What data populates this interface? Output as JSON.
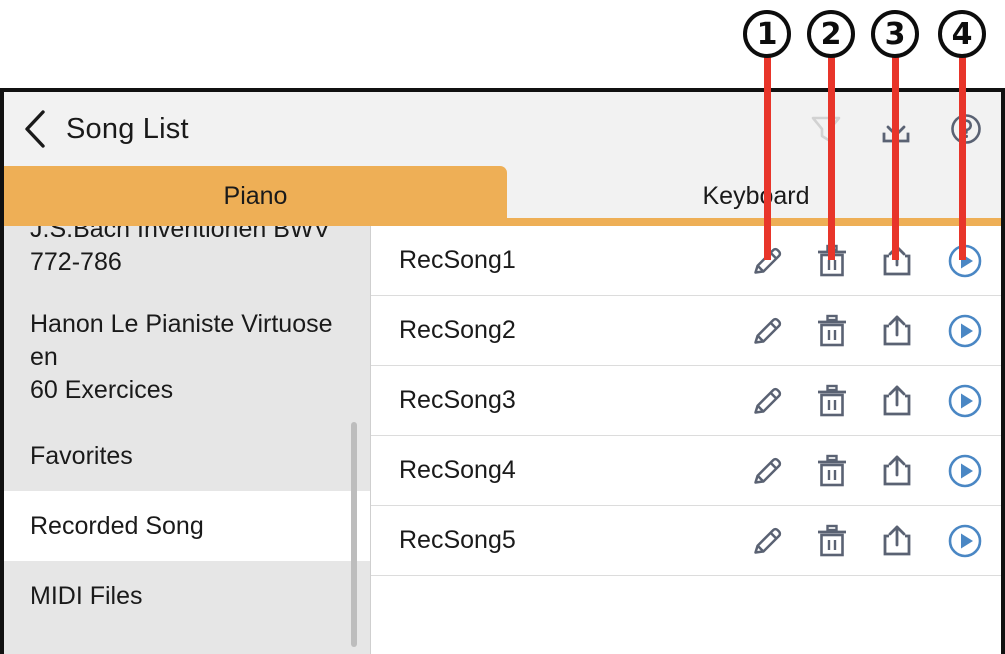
{
  "header": {
    "title": "Song List",
    "back_icon": "chevron-left-icon",
    "actions": [
      {
        "name": "filter-icon",
        "label": "Filter",
        "state": "disabled",
        "color": "#d2d2d2"
      },
      {
        "name": "import-icon",
        "label": "Import",
        "state": "enabled",
        "color": "#5a6273"
      },
      {
        "name": "help-icon",
        "label": "Help",
        "state": "enabled",
        "color": "#5a6273"
      }
    ]
  },
  "tabs": [
    {
      "label": "Piano",
      "active": true
    },
    {
      "label": "Keyboard",
      "active": false
    }
  ],
  "sidebar": {
    "items": [
      {
        "lines": [
          "J.S.Bach Inventionen BWV",
          "772-786"
        ],
        "selected": false,
        "size": "bach"
      },
      {
        "lines": [
          "Hanon Le Pianiste Virtuose",
          "en",
          "60 Exercices"
        ],
        "selected": false,
        "size": "hanon"
      },
      {
        "lines": [
          "Favorites"
        ],
        "selected": false,
        "size": "norm"
      },
      {
        "lines": [
          "Recorded Song"
        ],
        "selected": true,
        "size": "norm"
      },
      {
        "lines": [
          "MIDI Files"
        ],
        "selected": false,
        "size": "norm"
      }
    ]
  },
  "song_list": {
    "rows": [
      {
        "name": "RecSong1"
      },
      {
        "name": "RecSong2"
      },
      {
        "name": "RecSong3"
      },
      {
        "name": "RecSong4"
      },
      {
        "name": "RecSong5"
      }
    ],
    "row_actions": [
      {
        "name": "edit-icon",
        "label": "Edit"
      },
      {
        "name": "delete-icon",
        "label": "Delete"
      },
      {
        "name": "share-icon",
        "label": "Share"
      },
      {
        "name": "play-icon",
        "label": "Play"
      }
    ]
  },
  "callouts": [
    {
      "number": "1",
      "target": "edit-icon"
    },
    {
      "number": "2",
      "target": "delete-icon"
    },
    {
      "number": "3",
      "target": "share-icon"
    },
    {
      "number": "4",
      "target": "play-icon"
    }
  ],
  "colors": {
    "accent_orange": "#eeaf56",
    "callout_red": "#e8352a",
    "icon_gray": "#5a6273",
    "icon_disabled": "#d2d2d2",
    "play_blue": "#4a87c4",
    "sidebar_bg": "#e6e6e6",
    "header_bg": "#f2f2f2"
  }
}
